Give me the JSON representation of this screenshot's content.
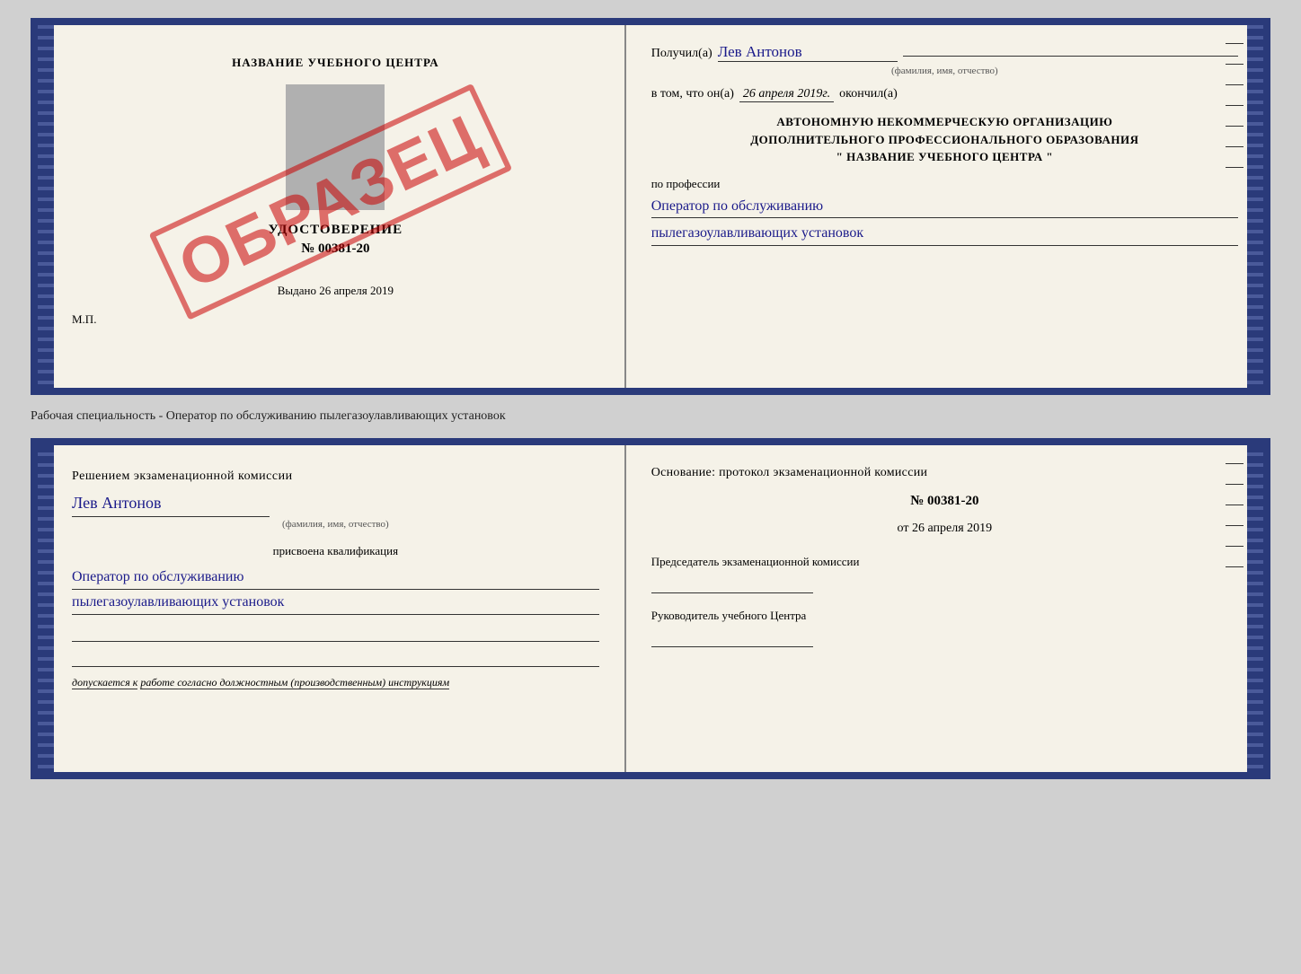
{
  "top_cert": {
    "left": {
      "school_name": "НАЗВАНИЕ УЧЕБНОГО ЦЕНТРА",
      "obrazec": "ОБРАЗЕЦ",
      "udost_title": "УДОСТОВЕРЕНИЕ",
      "udost_number": "№ 00381-20",
      "vydano_label": "Выдано",
      "vydano_date": "26 апреля 2019",
      "mp_label": "М.П."
    },
    "right": {
      "poluchil_label": "Получил(а)",
      "poluchil_name": "Лев Антонов",
      "fio_sub": "(фамилия, имя, отчество)",
      "v_tom_label": "в том, что он(а)",
      "date_value": "26 апреля 2019г.",
      "okonchil_label": "окончил(а)",
      "org_line1": "АВТОНОМНУЮ НЕКОММЕРЧЕСКУЮ ОРГАНИЗАЦИЮ",
      "org_line2": "ДОПОЛНИТЕЛЬНОГО ПРОФЕССИОНАЛЬНОГО ОБРАЗОВАНИЯ",
      "org_line3": "\" НАЗВАНИЕ УЧЕБНОГО ЦЕНТРА \"",
      "po_professii": "по профессии",
      "profession1": "Оператор по обслуживанию",
      "profession2": "пылегазоулавливающих установок"
    }
  },
  "specialty_line": "Рабочая специальность - Оператор по обслуживанию пылегазоулавливающих установок",
  "bottom_cert": {
    "left": {
      "resheniem_label": "Решением экзаменационной комиссии",
      "person_name": "Лев Антонов",
      "fio_sub": "(фамилия, имя, отчество)",
      "prisvoena_label": "присвоена квалификация",
      "kval1": "Оператор по обслуживанию",
      "kval2": "пылегазоулавливающих установок",
      "dopuskaetsya_label": "допускается к",
      "dopuskaetsya_value": "работе согласно должностным (производственным) инструкциям"
    },
    "right": {
      "osnovanie_label": "Основание: протокол экзаменационной комиссии",
      "protocol_number": "№ 00381-20",
      "ot_label": "от",
      "ot_date": "26 апреля 2019",
      "predsedatel_label": "Председатель экзаменационной комиссии",
      "rukovoditel_label": "Руководитель учебного Центра"
    }
  }
}
